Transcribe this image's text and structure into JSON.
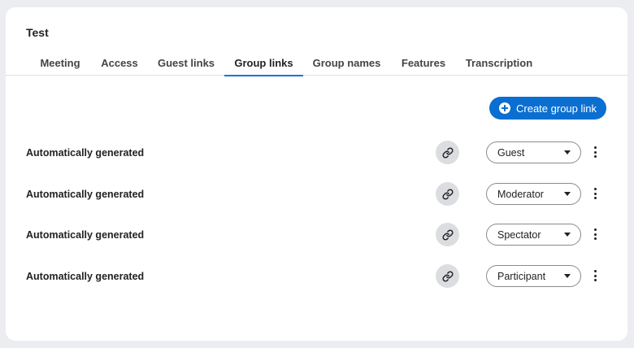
{
  "room": {
    "title": "Test"
  },
  "tabs": [
    {
      "label": "Meeting"
    },
    {
      "label": "Access"
    },
    {
      "label": "Guest links"
    },
    {
      "label": "Group links",
      "active": true
    },
    {
      "label": "Group names"
    },
    {
      "label": "Features"
    },
    {
      "label": "Transcription"
    }
  ],
  "actions": {
    "create_label": "Create group link"
  },
  "group_links": [
    {
      "name": "Automatically generated",
      "role": "Guest"
    },
    {
      "name": "Automatically generated",
      "role": "Moderator"
    },
    {
      "name": "Automatically generated",
      "role": "Spectator"
    },
    {
      "name": "Automatically generated",
      "role": "Participant"
    }
  ],
  "icons": {
    "link": "link-icon",
    "create": "plus-circle-icon",
    "dropdown": "caret-down-icon",
    "menu": "kebab-menu-icon"
  },
  "colors": {
    "accent": "#0a6fd1",
    "tab_indicator": "#1a74d6",
    "background": "#ebedf0",
    "link_button": "#dcdde1"
  }
}
